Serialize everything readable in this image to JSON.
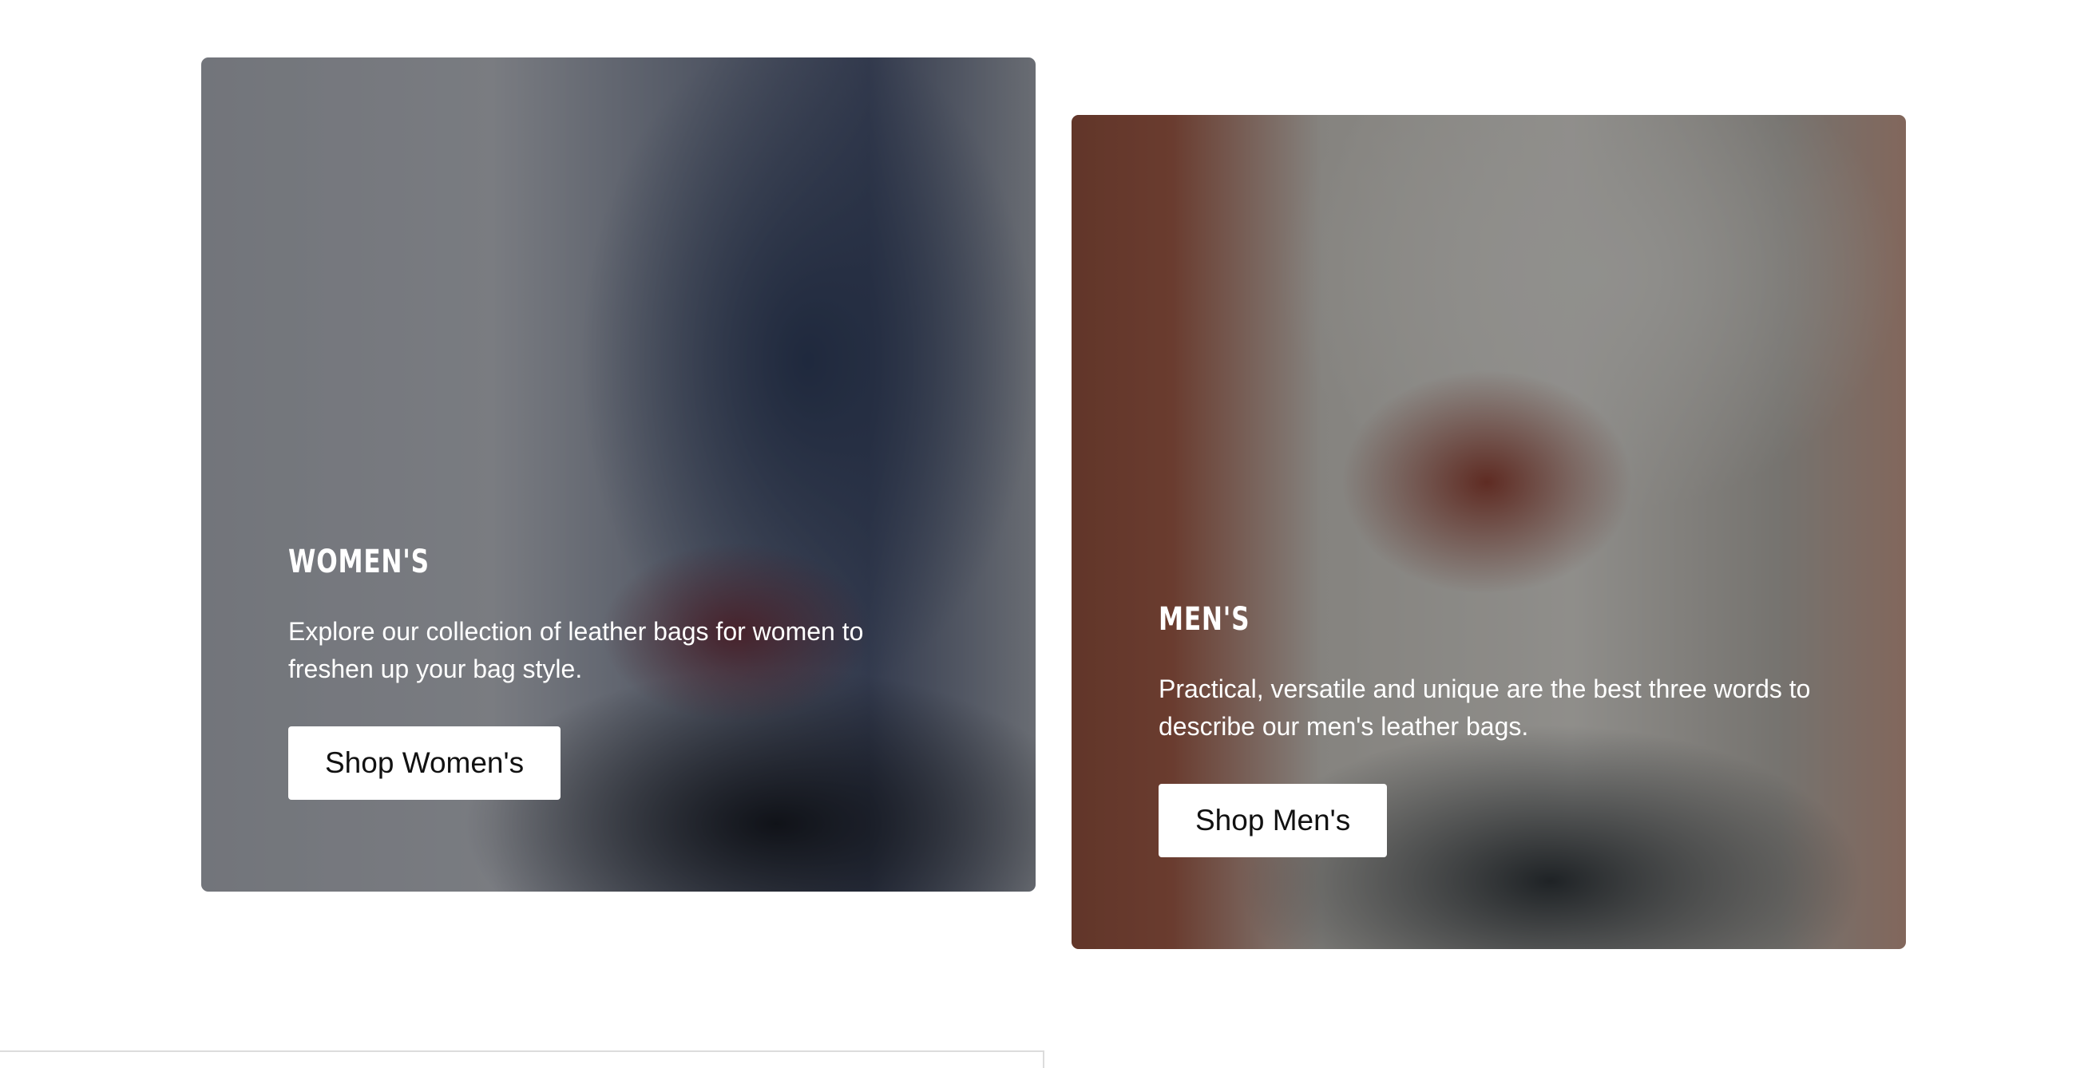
{
  "categories": {
    "womens": {
      "title": "WOMEN'S",
      "description": "Explore our collection of leather bags for women to freshen up your bag style.",
      "button_label": "Shop Women's"
    },
    "mens": {
      "title": "MEN'S",
      "description": "Practical, versatile and unique are the best three words to describe our men's leather bags.",
      "button_label": "Shop Men's"
    }
  },
  "colors": {
    "button_bg": "#ffffff",
    "button_text": "#111111",
    "card_text": "#ffffff",
    "page_bg": "#ffffff"
  }
}
